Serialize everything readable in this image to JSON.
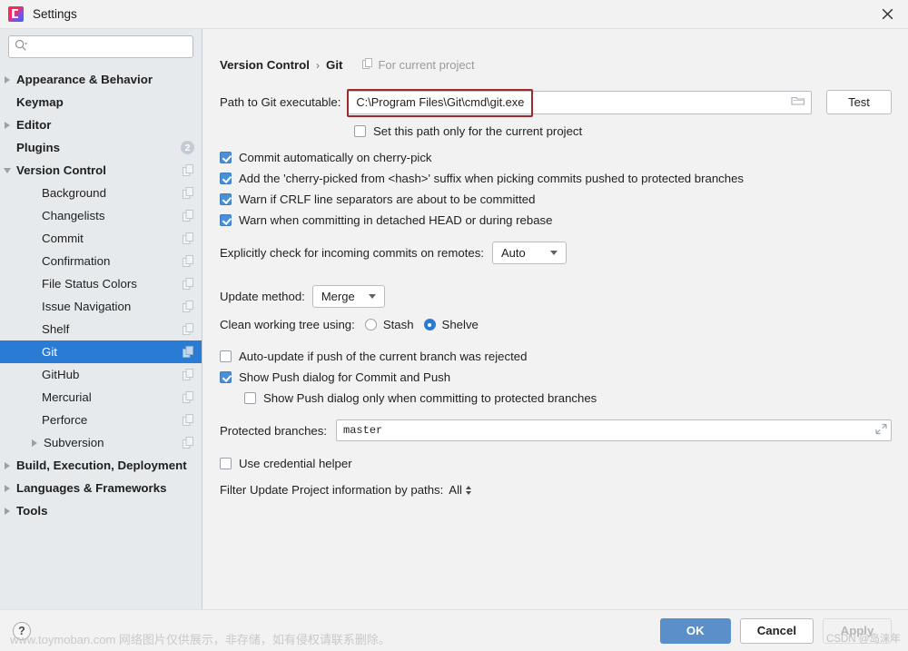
{
  "window": {
    "title": "Settings",
    "app_icon": "intellij-idea-logo",
    "close_icon": "close-icon"
  },
  "sidebar": {
    "search": {
      "placeholder": "",
      "value": "",
      "icon": "search-icon"
    },
    "items": [
      {
        "label": "Appearance & Behavior",
        "level": 0,
        "arrow": "right",
        "badge": "",
        "copy_icon": false,
        "selected": false
      },
      {
        "label": "Keymap",
        "level": 0,
        "arrow": "none",
        "badge": "",
        "copy_icon": false,
        "selected": false
      },
      {
        "label": "Editor",
        "level": 0,
        "arrow": "right",
        "badge": "",
        "copy_icon": false,
        "selected": false
      },
      {
        "label": "Plugins",
        "level": 0,
        "arrow": "none",
        "badge": "2",
        "copy_icon": false,
        "selected": false
      },
      {
        "label": "Version Control",
        "level": 0,
        "arrow": "down",
        "badge": "",
        "copy_icon": true,
        "selected": false
      },
      {
        "label": "Background",
        "level": 1,
        "arrow": "none",
        "badge": "",
        "copy_icon": true,
        "selected": false
      },
      {
        "label": "Changelists",
        "level": 1,
        "arrow": "none",
        "badge": "",
        "copy_icon": true,
        "selected": false
      },
      {
        "label": "Commit",
        "level": 1,
        "arrow": "none",
        "badge": "",
        "copy_icon": true,
        "selected": false
      },
      {
        "label": "Confirmation",
        "level": 1,
        "arrow": "none",
        "badge": "",
        "copy_icon": true,
        "selected": false
      },
      {
        "label": "File Status Colors",
        "level": 1,
        "arrow": "none",
        "badge": "",
        "copy_icon": true,
        "selected": false
      },
      {
        "label": "Issue Navigation",
        "level": 1,
        "arrow": "none",
        "badge": "",
        "copy_icon": true,
        "selected": false
      },
      {
        "label": "Shelf",
        "level": 1,
        "arrow": "none",
        "badge": "",
        "copy_icon": true,
        "selected": false
      },
      {
        "label": "Git",
        "level": 1,
        "arrow": "none",
        "badge": "",
        "copy_icon": true,
        "selected": true
      },
      {
        "label": "GitHub",
        "level": 1,
        "arrow": "none",
        "badge": "",
        "copy_icon": true,
        "selected": false
      },
      {
        "label": "Mercurial",
        "level": 1,
        "arrow": "none",
        "badge": "",
        "copy_icon": true,
        "selected": false
      },
      {
        "label": "Perforce",
        "level": 1,
        "arrow": "none",
        "badge": "",
        "copy_icon": true,
        "selected": false
      },
      {
        "label": "Subversion",
        "level": 1,
        "arrow": "right",
        "badge": "",
        "copy_icon": true,
        "selected": false
      },
      {
        "label": "Build, Execution, Deployment",
        "level": 0,
        "arrow": "right",
        "badge": "",
        "copy_icon": false,
        "selected": false
      },
      {
        "label": "Languages & Frameworks",
        "level": 0,
        "arrow": "right",
        "badge": "",
        "copy_icon": false,
        "selected": false
      },
      {
        "label": "Tools",
        "level": 0,
        "arrow": "right",
        "badge": "",
        "copy_icon": false,
        "selected": false
      }
    ]
  },
  "main": {
    "breadcrumb": {
      "root": "Version Control",
      "separator": "›",
      "current": "Git"
    },
    "for_current_project": {
      "label": "For current project",
      "icon": "copy-icon"
    },
    "path_row": {
      "label": "Path to Git executable:",
      "value": "C:\\Program Files\\Git\\cmd\\git.exe",
      "browse_icon": "folder-icon",
      "test_button": "Test"
    },
    "set_path_only": {
      "label": "Set this path only for the current project",
      "checked": false
    },
    "checkboxes": [
      {
        "label": "Commit automatically on cherry-pick",
        "checked": true
      },
      {
        "label": "Add the 'cherry-picked from <hash>' suffix when picking commits pushed to protected branches",
        "checked": true
      },
      {
        "label": "Warn if CRLF line separators are about to be committed",
        "checked": true
      },
      {
        "label": "Warn when committing in detached HEAD or during rebase",
        "checked": true
      }
    ],
    "incoming_commits": {
      "label": "Explicitly check for incoming commits on remotes:",
      "value": "Auto"
    },
    "update_method": {
      "label": "Update method:",
      "value": "Merge"
    },
    "clean_working_tree": {
      "label": "Clean working tree using:",
      "options": [
        "Stash",
        "Shelve"
      ],
      "selected": "Shelve"
    },
    "push_checkboxes": [
      {
        "label": "Auto-update if push of the current branch was rejected",
        "checked": false
      },
      {
        "label": "Show Push dialog for Commit and Push",
        "checked": true
      }
    ],
    "push_sub_checkbox": {
      "label": "Show Push dialog only when committing to protected branches",
      "checked": false
    },
    "protected_branches": {
      "label": "Protected branches:",
      "value": "master",
      "expand_icon": "expand-icon"
    },
    "credential_helper": {
      "label": "Use credential helper",
      "checked": false
    },
    "filter_paths": {
      "label": "Filter Update Project information by paths:",
      "value": "All"
    }
  },
  "footer": {
    "help_label": "?",
    "ok": "OK",
    "cancel": "Cancel",
    "apply": "Apply"
  },
  "watermarks": {
    "bottom_left": "www.toymoban.com 网络图片仅供展示，非存储，如有侵权请联系删除。",
    "bottom_right": "CSDN @岛涞年"
  },
  "colors": {
    "selection": "#2a7bd4",
    "checkbox": "#4a90d9",
    "primary_button": "#5a8fc9",
    "annotation": "#9e2b2b",
    "sidebar_bg": "#e6eaed"
  }
}
